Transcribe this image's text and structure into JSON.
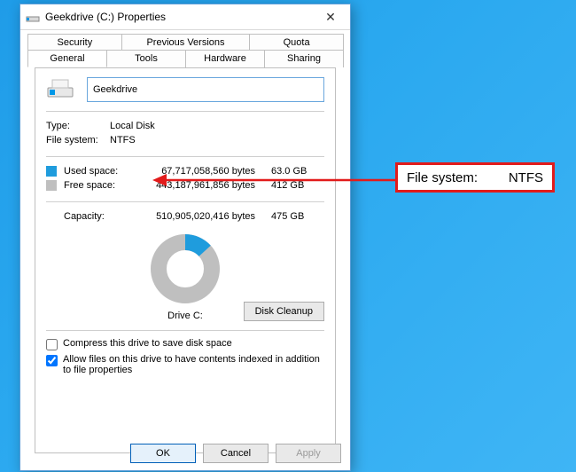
{
  "colors": {
    "accent": "#0098e8",
    "used": "#1f9cdd",
    "free": "#bfbfbf",
    "disabled": "#9a9a9a",
    "callout_border": "#e21b1b"
  },
  "titlebar": {
    "title": "Geekdrive (C:) Properties",
    "close_label": "✕"
  },
  "tabs": {
    "row1": [
      {
        "label": "Security"
      },
      {
        "label": "Previous Versions"
      },
      {
        "label": "Quota"
      }
    ],
    "row2": [
      {
        "label": "General",
        "active": true
      },
      {
        "label": "Tools"
      },
      {
        "label": "Hardware"
      },
      {
        "label": "Sharing"
      }
    ]
  },
  "general": {
    "name_value": "Geekdrive",
    "type_label": "Type:",
    "type_value": "Local Disk",
    "fs_label": "File system:",
    "fs_value": "NTFS",
    "used_label": "Used space:",
    "used_bytes": "67,717,058,560 bytes",
    "used_hr": "63.0 GB",
    "free_label": "Free space:",
    "free_bytes": "443,187,961,856 bytes",
    "free_hr": "412 GB",
    "cap_label": "Capacity:",
    "cap_bytes": "510,905,020,416 bytes",
    "cap_hr": "475 GB",
    "drive_caption": "Drive C:",
    "cleanup_label": "Disk Cleanup",
    "compress_label": "Compress this drive to save disk space",
    "index_label": "Allow files on this drive to have contents indexed in addition to file properties",
    "disk_used_fraction": 0.132
  },
  "buttons": {
    "ok": "OK",
    "cancel": "Cancel",
    "apply": "Apply"
  },
  "callout": {
    "label": "File system:",
    "value": "NTFS"
  }
}
